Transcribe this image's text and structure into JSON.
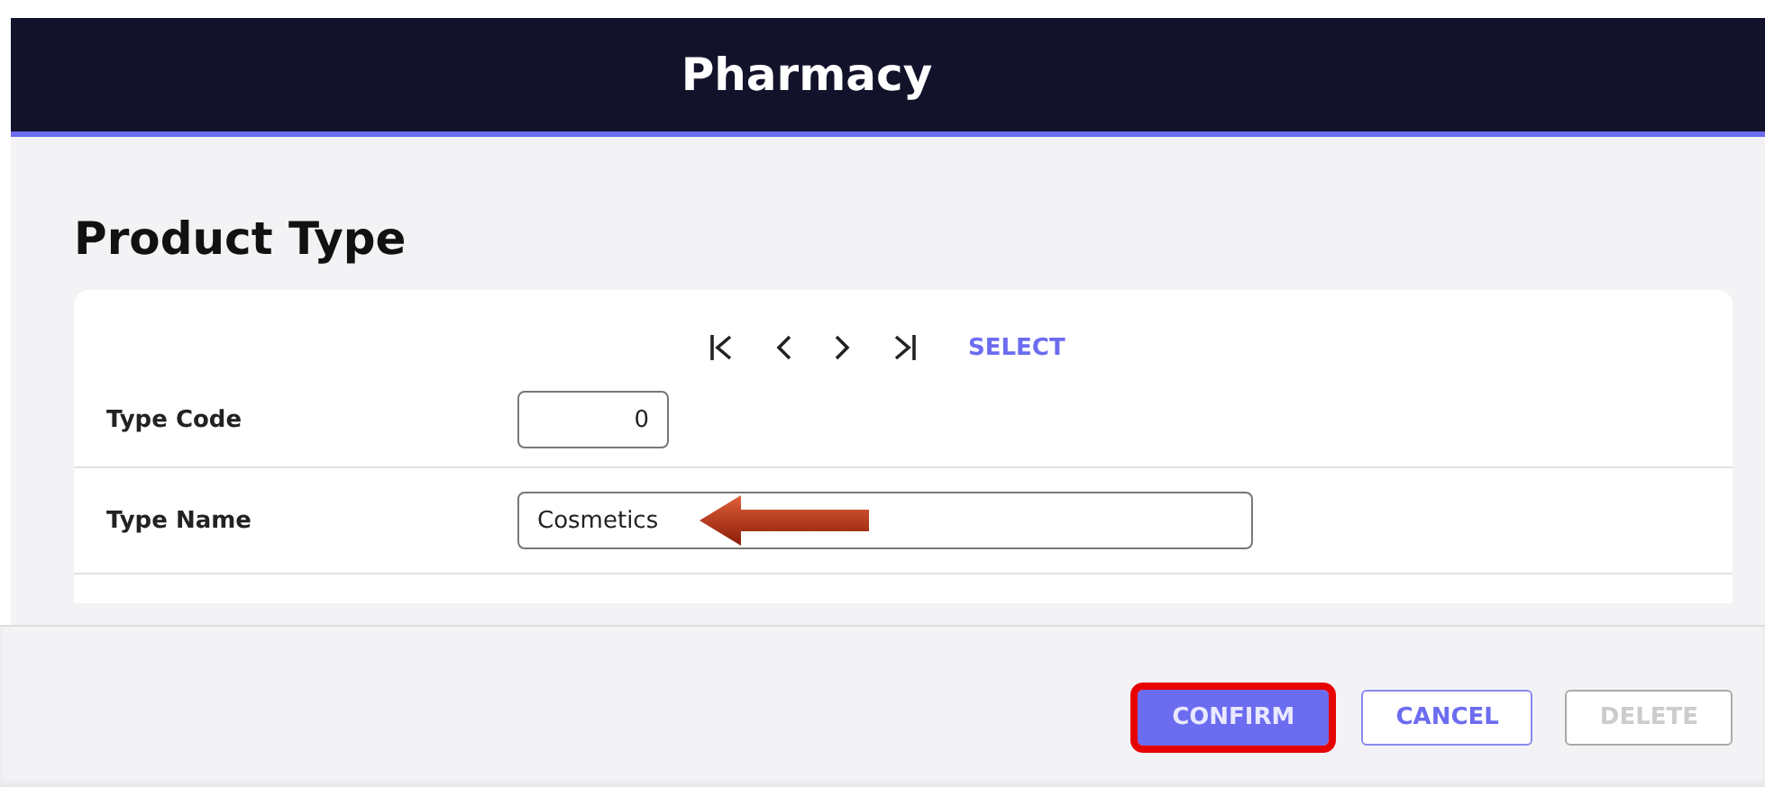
{
  "header": {
    "title": "Pharmacy"
  },
  "page": {
    "title": "Product Type"
  },
  "navigation": {
    "select_label": "SELECT"
  },
  "fields": [
    {
      "label": "Type Code",
      "value": "0",
      "kind": "short",
      "pointed": false
    },
    {
      "label": "Type Name",
      "value": "Cosmetics",
      "kind": "wide",
      "pointed": true
    }
  ],
  "buttons": [
    {
      "label": "CONFIRM",
      "kind": "primary",
      "disabled": false,
      "highlighted": true
    },
    {
      "label": "CANCEL",
      "kind": "secondary",
      "disabled": false,
      "highlighted": false
    },
    {
      "label": "DELETE",
      "kind": "secondary",
      "disabled": true,
      "highlighted": false
    }
  ]
}
